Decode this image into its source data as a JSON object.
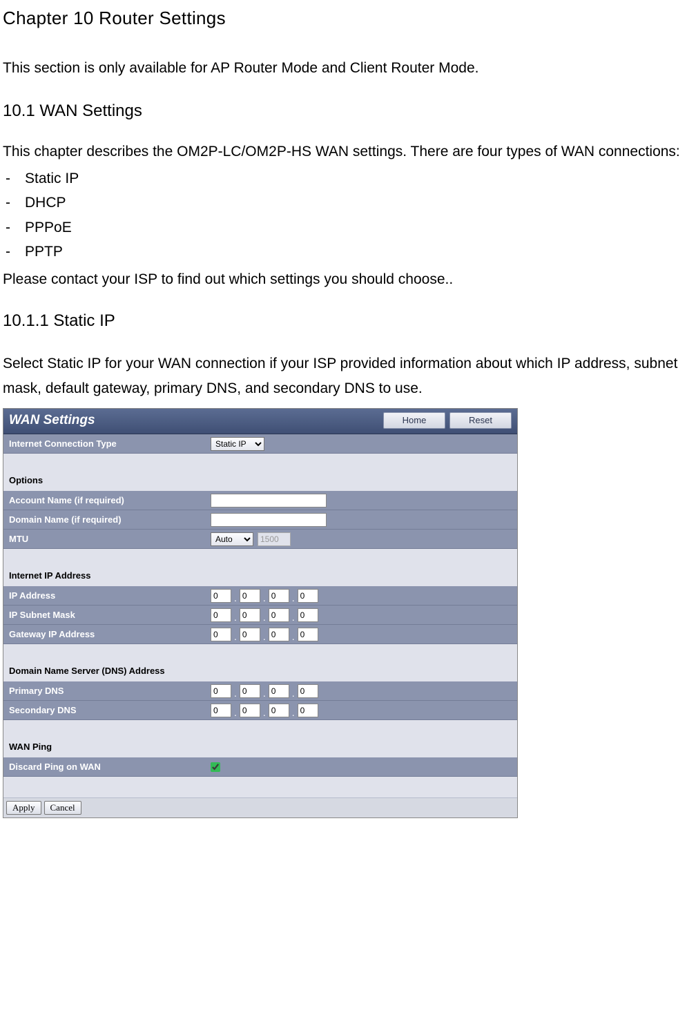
{
  "chapter_title": "Chapter 10 Router Settings",
  "intro_line": "This section is only available for AP Router Mode  and Client Router Mode.",
  "section_10_1": "10.1 WAN  Settings",
  "desc_10_1": "This chapter describes the OM2P-LC/OM2P-HS WAN settings. There are four types of WAN connections:",
  "bullets": [
    "Static IP",
    "DHCP",
    "PPPoE",
    "PPTP"
  ],
  "isp_note": "Please contact your ISP to find out which settings you should choose..",
  "section_10_1_1": "10.1.1 Static IP",
  "static_ip_desc": "Select Static IP for your WAN connection if your ISP provided information  about which IP address, subnet mask, default gateway, primary DNS, and secondary  DNS to use.",
  "panel": {
    "title": "WAN Settings",
    "btn_home": "Home",
    "btn_reset": "Reset",
    "label_connection_type": "Internet Connection Type",
    "val_connection_type": "Static IP",
    "heading_options": "Options",
    "label_account_name": "Account Name (if required)",
    "label_domain_name": "Domain Name (if required)",
    "label_mtu": "MTU",
    "mtu_mode": "Auto",
    "mtu_value": "1500",
    "heading_ip": "Internet IP Address",
    "label_ip_address": "IP Address",
    "label_subnet": "IP Subnet Mask",
    "label_gateway": "Gateway IP Address",
    "heading_dns": "Domain Name Server (DNS) Address",
    "label_primary_dns": "Primary DNS",
    "label_secondary_dns": "Secondary DNS",
    "heading_wanping": "WAN Ping",
    "label_discard_ping": "Discard Ping on WAN",
    "ip": {
      "a": "0",
      "b": "0",
      "c": "0",
      "d": "0"
    },
    "subnet": {
      "a": "0",
      "b": "0",
      "c": "0",
      "d": "0"
    },
    "gateway": {
      "a": "0",
      "b": "0",
      "c": "0",
      "d": "0"
    },
    "pdns": {
      "a": "0",
      "b": "0",
      "c": "0",
      "d": "0"
    },
    "sdns": {
      "a": "0",
      "b": "0",
      "c": "0",
      "d": "0"
    },
    "btn_apply": "Apply",
    "btn_cancel": "Cancel"
  }
}
